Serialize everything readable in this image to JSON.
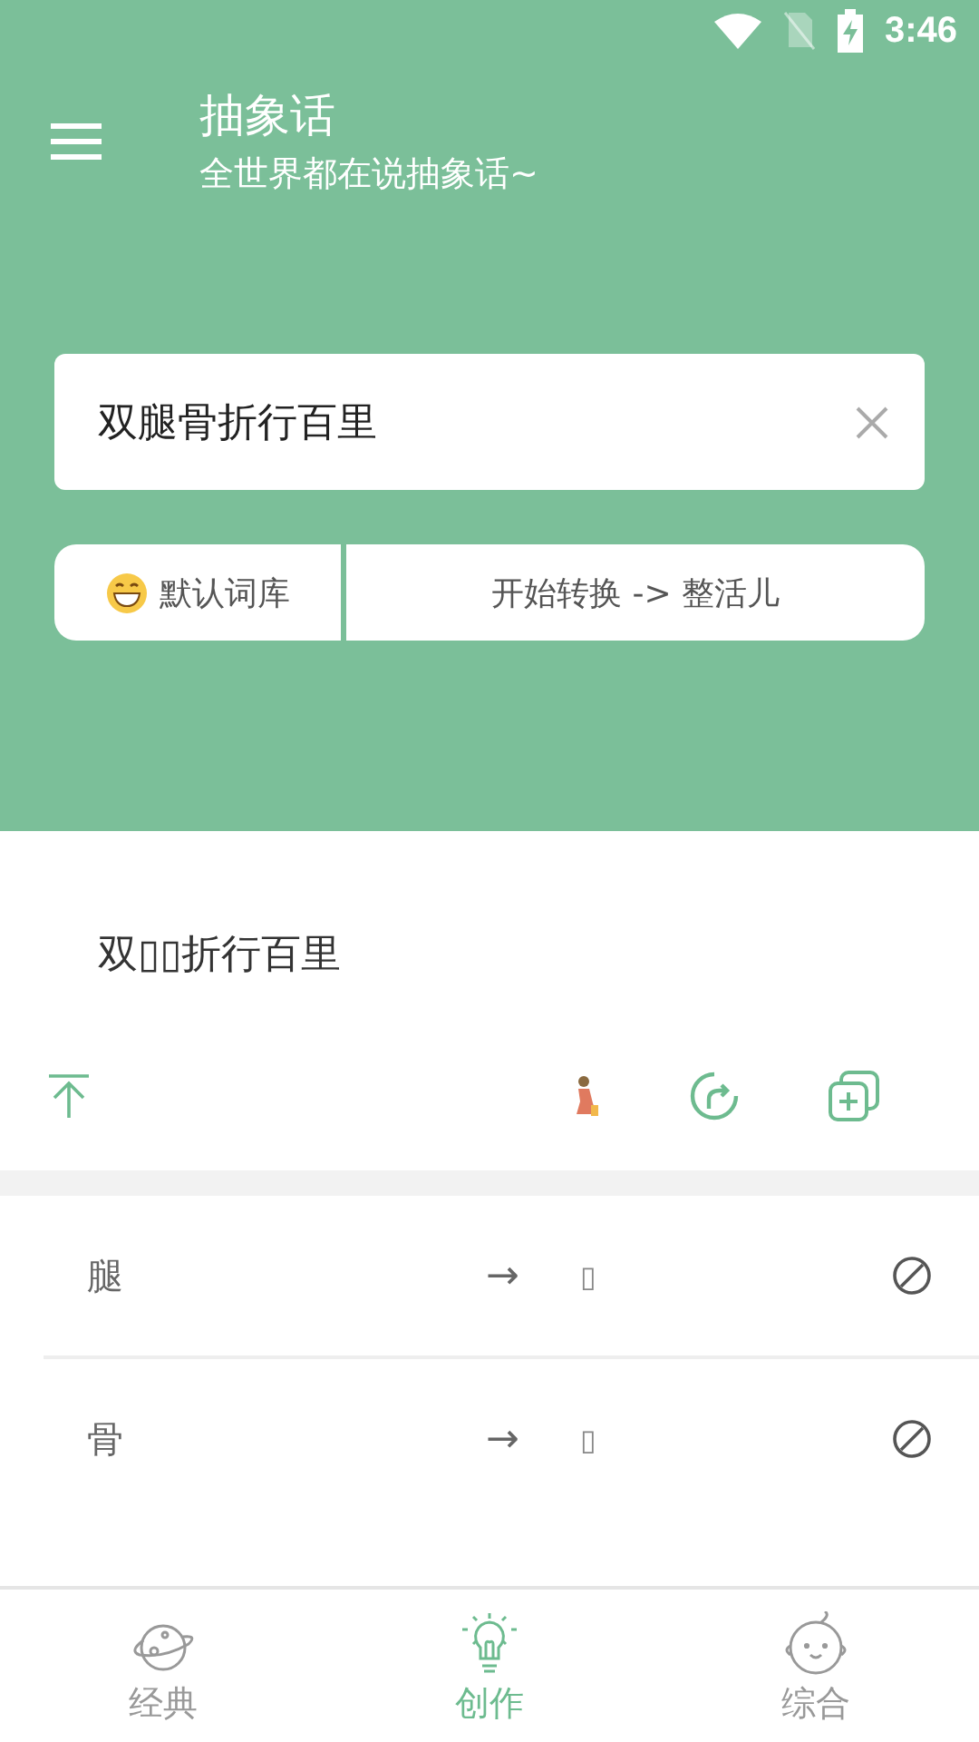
{
  "status_bar": {
    "time": "3:46"
  },
  "app_bar": {
    "title": "抽象话",
    "subtitle": "全世界都在说抽象话~"
  },
  "input": {
    "value": "双腿骨折行百里"
  },
  "dictionary_button": {
    "label": "默认词库"
  },
  "convert_button": {
    "label": "开始转换 -> 整活儿"
  },
  "result": {
    "text": "双▯▯折行百里"
  },
  "replacements": [
    {
      "source": "腿",
      "arrow": "→",
      "target": "▯"
    },
    {
      "source": "骨",
      "arrow": "→",
      "target": "▯"
    }
  ],
  "bottom_nav": [
    {
      "label": "经典",
      "kind": "planet",
      "selected": false
    },
    {
      "label": "创作",
      "kind": "bulb",
      "selected": true
    },
    {
      "label": "综合",
      "kind": "baby",
      "selected": false
    }
  ]
}
